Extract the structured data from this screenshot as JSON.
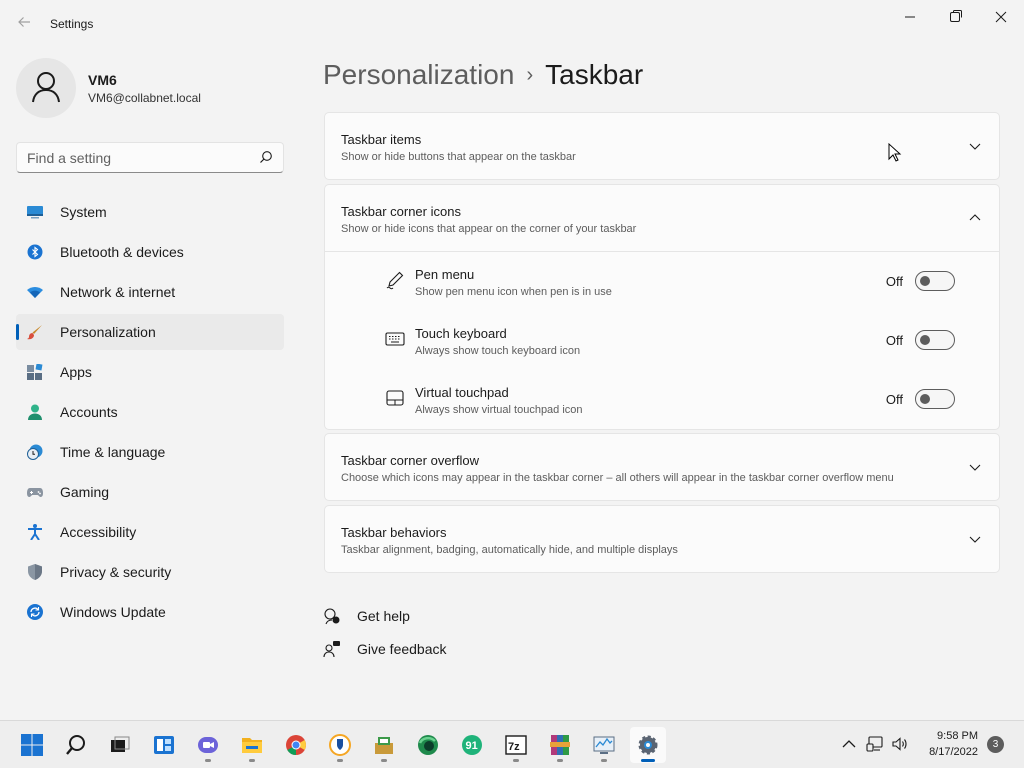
{
  "window": {
    "title": "Settings",
    "back_icon": "arrow-left-icon",
    "controls": [
      "minimize-icon",
      "maximize-icon",
      "close-icon"
    ]
  },
  "profile": {
    "name": "VM6",
    "email": "VM6@collabnet.local"
  },
  "search": {
    "placeholder": "Find a setting",
    "value": ""
  },
  "sidebar": {
    "items": [
      {
        "label": "System",
        "icon": "system-icon"
      },
      {
        "label": "Bluetooth & devices",
        "icon": "bluetooth-icon"
      },
      {
        "label": "Network & internet",
        "icon": "wifi-icon"
      },
      {
        "label": "Personalization",
        "icon": "brush-icon",
        "selected": true
      },
      {
        "label": "Apps",
        "icon": "apps-icon"
      },
      {
        "label": "Accounts",
        "icon": "accounts-icon"
      },
      {
        "label": "Time & language",
        "icon": "clock-icon"
      },
      {
        "label": "Gaming",
        "icon": "gamepad-icon"
      },
      {
        "label": "Accessibility",
        "icon": "accessibility-icon"
      },
      {
        "label": "Privacy & security",
        "icon": "shield-icon"
      },
      {
        "label": "Windows Update",
        "icon": "update-icon"
      }
    ]
  },
  "breadcrumb": {
    "parent": "Personalization",
    "separator": "›",
    "current": "Taskbar"
  },
  "sections": [
    {
      "title": "Taskbar items",
      "description": "Show or hide buttons that appear on the taskbar",
      "expanded": false
    },
    {
      "title": "Taskbar corner icons",
      "description": "Show or hide icons that appear on the corner of your taskbar",
      "expanded": true,
      "items": [
        {
          "title": "Pen menu",
          "description": "Show pen menu icon when pen is in use",
          "state": "Off",
          "icon": "pen-icon"
        },
        {
          "title": "Touch keyboard",
          "description": "Always show touch keyboard icon",
          "state": "Off",
          "icon": "keyboard-icon"
        },
        {
          "title": "Virtual touchpad",
          "description": "Always show virtual touchpad icon",
          "state": "Off",
          "icon": "touchpad-icon"
        }
      ]
    },
    {
      "title": "Taskbar corner overflow",
      "description": "Choose which icons may appear in the taskbar corner – all others will appear in the taskbar corner overflow menu",
      "expanded": false
    },
    {
      "title": "Taskbar behaviors",
      "description": "Taskbar alignment, badging, automatically hide, and multiple displays",
      "expanded": false
    }
  ],
  "help_links": [
    {
      "label": "Get help",
      "icon": "help-icon"
    },
    {
      "label": "Give feedback",
      "icon": "feedback-icon"
    }
  ],
  "taskbar": {
    "apps": [
      "start-icon",
      "search-icon",
      "task-view-icon",
      "widgets-icon",
      "teams-chat-icon",
      "file-explorer-icon",
      "chrome-icon",
      "bitwarden-icon",
      "installer-icon",
      "edge-dev-icon",
      "app-icon",
      "7zip-icon",
      "winrar-icon",
      "performance-monitor-icon",
      "settings-icon"
    ],
    "tray_icons": [
      "chevron-up-icon",
      "network-icon",
      "volume-icon"
    ],
    "time": "9:58 PM",
    "date": "8/17/2022",
    "notification_count": "3"
  },
  "colors": {
    "accent": "#005fb8",
    "background": "#f3f3f3",
    "card": "#fbfbfb"
  }
}
